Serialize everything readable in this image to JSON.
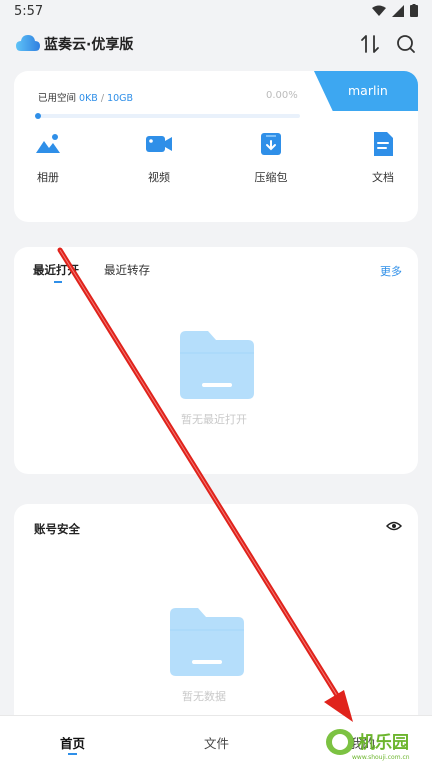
{
  "status_bar": {
    "time": "5:57"
  },
  "app_bar": {
    "title": "蓝奏云·优享版",
    "icons": [
      "cloud-logo",
      "sort-icon",
      "search-icon"
    ]
  },
  "storage": {
    "used_prefix": "已用空间 ",
    "used": "0KB",
    "separator": " / ",
    "total": "10GB",
    "percent": "0.00%",
    "progress_fraction": 0.0,
    "username": "marlin"
  },
  "categories": [
    {
      "label": "相册",
      "icon": "photo-icon"
    },
    {
      "label": "视频",
      "icon": "video-icon"
    },
    {
      "label": "压缩包",
      "icon": "archive-icon"
    },
    {
      "label": "文档",
      "icon": "document-icon"
    }
  ],
  "recent": {
    "tabs": [
      "最近打开",
      "最近转存"
    ],
    "more": "更多",
    "empty_text": "暂无最近打开"
  },
  "security": {
    "title": "账号安全",
    "empty_text": "暂无数据"
  },
  "bottom_nav": {
    "items": [
      "首页",
      "文件",
      "我的"
    ]
  },
  "watermark": {
    "text": "机乐园",
    "url_text": "www.shouji.com.cn"
  },
  "colors": {
    "accent": "#2f8fe8",
    "user_tab": "#3da7f1",
    "folder": "#b5defb",
    "arrow": "#e0231c"
  }
}
